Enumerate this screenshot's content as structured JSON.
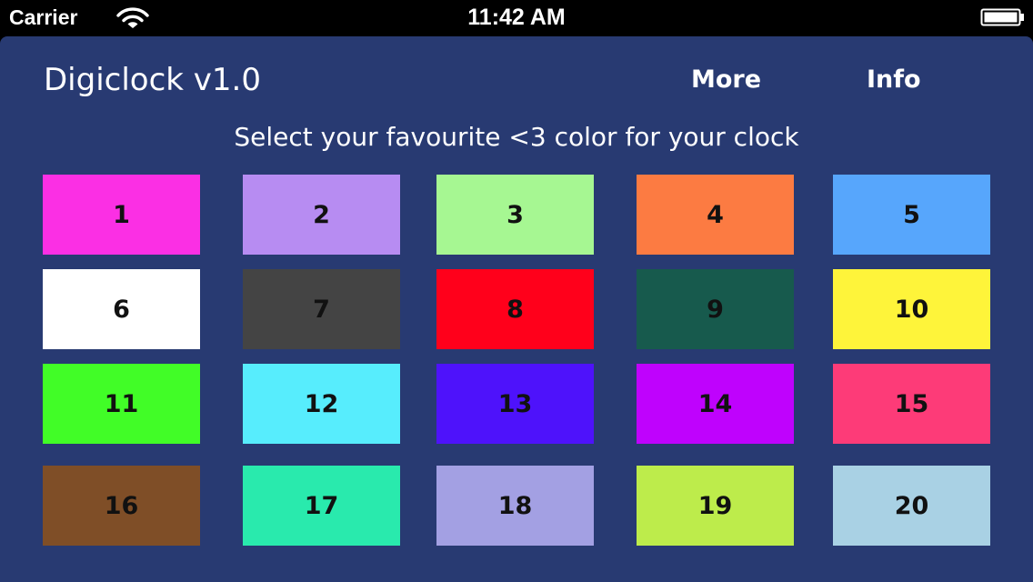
{
  "status_bar": {
    "carrier": "Carrier",
    "time": "11:42 AM",
    "wifi_icon": "wifi-icon",
    "battery_icon": "battery-icon"
  },
  "app": {
    "title": "Digiclock v1.0",
    "more_label": "More",
    "info_label": "Info",
    "subtitle": "Select your favourite <3 color for your clock",
    "panel_color": "#283a72"
  },
  "swatches": [
    {
      "label": "1",
      "color": "#fb2fe4"
    },
    {
      "label": "2",
      "color": "#b78cf2"
    },
    {
      "label": "3",
      "color": "#a6f792"
    },
    {
      "label": "4",
      "color": "#fc7b42"
    },
    {
      "label": "5",
      "color": "#57a6fc"
    },
    {
      "label": "6",
      "color": "#ffffff"
    },
    {
      "label": "7",
      "color": "#444444"
    },
    {
      "label": "8",
      "color": "#ff001b"
    },
    {
      "label": "9",
      "color": "#175a4d"
    },
    {
      "label": "10",
      "color": "#fef43a"
    },
    {
      "label": "11",
      "color": "#41fd27"
    },
    {
      "label": "12",
      "color": "#57edfd"
    },
    {
      "label": "13",
      "color": "#4e12fb"
    },
    {
      "label": "14",
      "color": "#bf02fd"
    },
    {
      "label": "15",
      "color": "#fd3b78"
    },
    {
      "label": "16",
      "color": "#7f4e27"
    },
    {
      "label": "17",
      "color": "#29eaad"
    },
    {
      "label": "18",
      "color": "#a3a0e3"
    },
    {
      "label": "19",
      "color": "#bdec4b"
    },
    {
      "label": "20",
      "color": "#a9d1e4"
    }
  ]
}
